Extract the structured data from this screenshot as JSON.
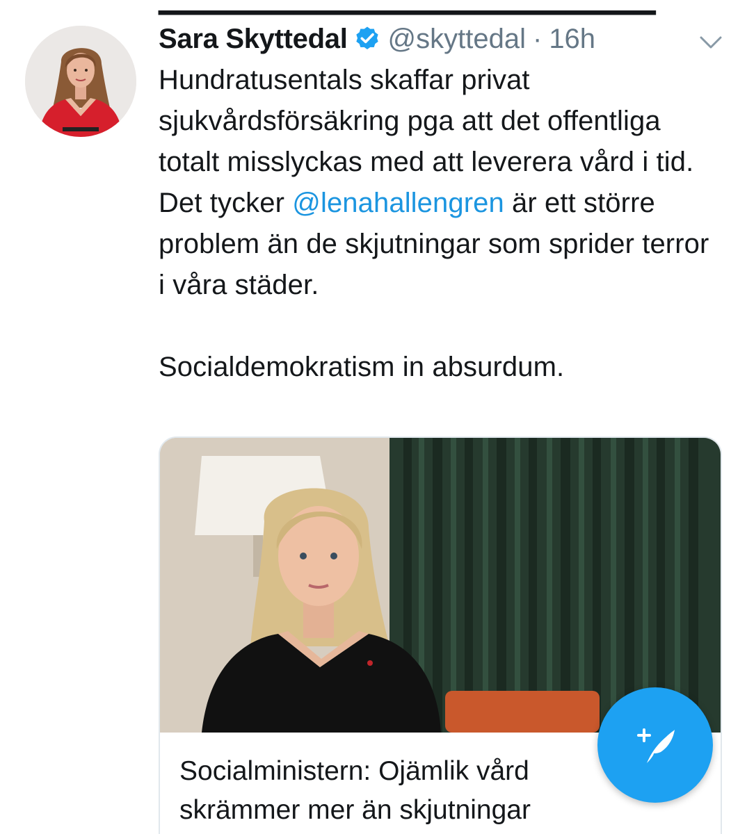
{
  "tweet": {
    "display_name": "Sara Skyttedal",
    "handle": "@skyttedal",
    "separator": "·",
    "timestamp": "16h",
    "text_before": "Hundratusentals skaffar privat sjukvårdsförsäkring pga att det offentliga totalt misslyckas med att leverera vård i tid. Det tycker ",
    "mention": "@lenahallengren",
    "text_after": " är ett större problem än de skjutningar som sprider terror i våra städer.\n\nSocialdemokratism in absurdum.",
    "verified": true
  },
  "card": {
    "title": "Socialministern: Ojämlik vård skrämmer mer än skjutningar"
  },
  "icons": {
    "verified": "verified-badge-icon",
    "more": "chevron-down-icon",
    "compose": "compose-tweet-icon"
  },
  "colors": {
    "link": "#1b95e0",
    "fab": "#1da1f2",
    "secondary_text": "#657786"
  }
}
